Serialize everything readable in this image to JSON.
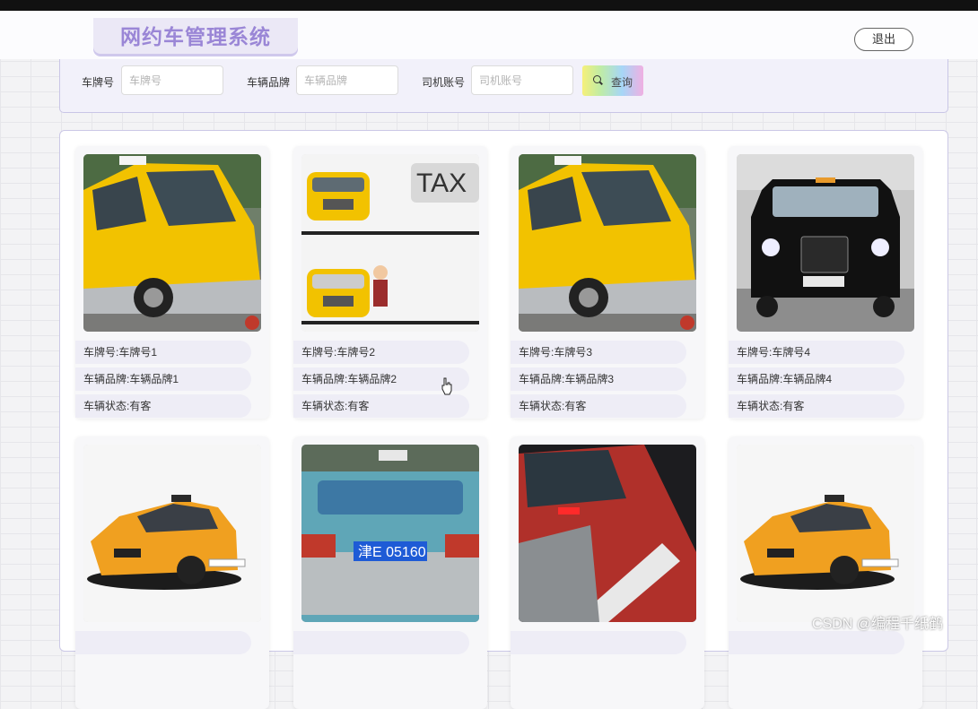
{
  "header": {
    "title": "网约车管理系统",
    "logout_label": "退出"
  },
  "search": {
    "plate_label": "车牌号",
    "plate_placeholder": "车牌号",
    "brand_label": "车辆品牌",
    "brand_placeholder": "车辆品牌",
    "driver_label": "司机账号",
    "driver_placeholder": "司机账号",
    "button_label": "查询",
    "button_icon": "search-icon"
  },
  "cards": [
    {
      "plate": "车牌号:车牌号1",
      "brand": "车辆品牌:车辆品牌1",
      "status": "车辆状态:有客"
    },
    {
      "plate": "车牌号:车牌号2",
      "brand": "车辆品牌:车辆品牌2",
      "status": "车辆状态:有客",
      "image_text": "TAX"
    },
    {
      "plate": "车牌号:车牌号3",
      "brand": "车辆品牌:车辆品牌3",
      "status": "车辆状态:有客"
    },
    {
      "plate": "车牌号:车牌号4",
      "brand": "车辆品牌:车辆品牌4",
      "status": "车辆状态:有客"
    },
    {
      "plate": "",
      "brand": "",
      "status": ""
    },
    {
      "plate": "",
      "brand": "",
      "status": "",
      "image_text": "津E 05160"
    },
    {
      "plate": "",
      "brand": "",
      "status": ""
    },
    {
      "plate": "",
      "brand": "",
      "status": ""
    }
  ],
  "watermark": "CSDN @编程千纸鹤",
  "colors": {
    "accent": "#9a86d6",
    "panel_border": "#c9c6e6",
    "taxi_yellow": "#f2c200",
    "taxi_orange": "#f0a020"
  }
}
